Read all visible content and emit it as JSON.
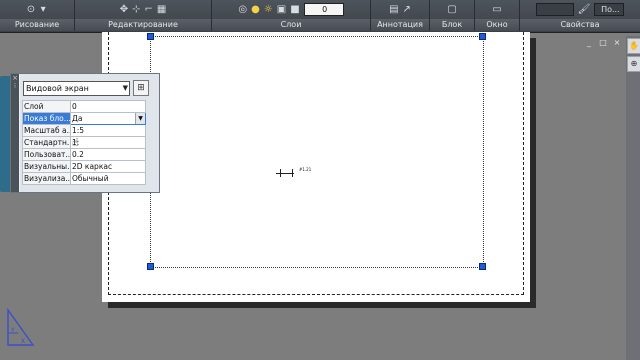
{
  "ribbon": {
    "panels": [
      {
        "title": "Рисование",
        "icons": [
          "circle-icon",
          "dropdown-icon"
        ]
      },
      {
        "title": "Редактирование",
        "icons": [
          "move-icon",
          "trim-icon",
          "fillet-icon",
          "array-icon"
        ]
      },
      {
        "title": "Слои",
        "layer_combo": "0",
        "icons": [
          "layer-state-icon",
          "lightbulb-icon",
          "sun-icon",
          "lock-icon",
          "color-icon"
        ]
      },
      {
        "title": "Аннотация",
        "icons": [
          "table-icon",
          "leader-icon"
        ]
      },
      {
        "title": "Блок",
        "icons": [
          "insert-block-icon"
        ]
      },
      {
        "title": "Окно",
        "icons": [
          "window-icon"
        ]
      },
      {
        "title": "Свойства",
        "linetype_combo": "",
        "properties_combo": "По..."
      }
    ]
  },
  "window_controls": [
    "_",
    "□",
    "×"
  ],
  "quick_properties": {
    "object_type": "Видовой экран",
    "rows": [
      {
        "key": "Слой",
        "value": "0"
      },
      {
        "key": "Показ бло...",
        "value": "Да",
        "selected": true
      },
      {
        "key": "Масштаб а...",
        "value": "1:5"
      },
      {
        "key": "Стандартн...",
        "value": "1:"
      },
      {
        "key": "Пользоват...",
        "value": "0.2"
      },
      {
        "key": "Визуальны...",
        "value": "2D каркас"
      },
      {
        "key": "Визуализа...",
        "value": "Обычный"
      }
    ]
  },
  "cursor_tag": "#1.21",
  "colors": {
    "ribbon_bg": "#43484e",
    "model_bg": "#7d7d7d",
    "grip": "#1e5bd8",
    "selected_row": "#3a7bd5"
  }
}
